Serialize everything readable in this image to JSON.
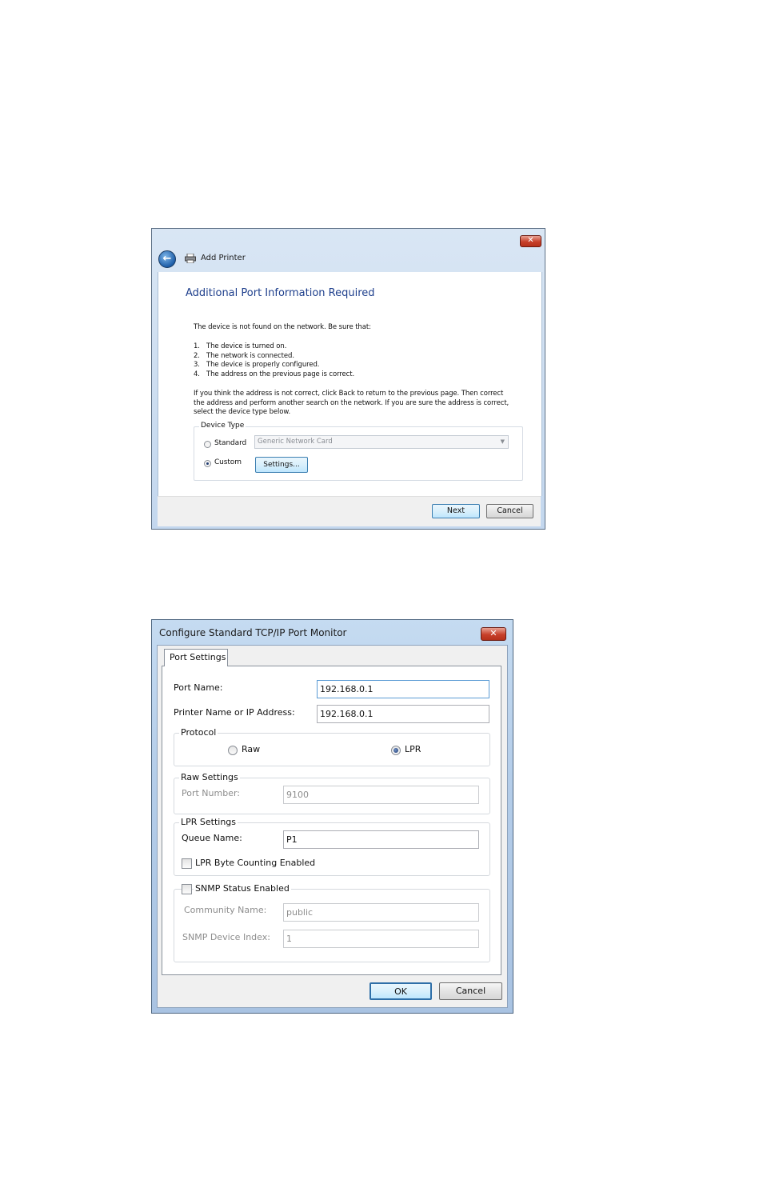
{
  "add_printer": {
    "title": "Add Printer",
    "heading": "Additional Port Information Required",
    "intro": "The device is not found on the network.  Be sure that:",
    "checks": [
      {
        "num": "1.",
        "text": "The device is turned on."
      },
      {
        "num": "2.",
        "text": "The network is connected."
      },
      {
        "num": "3.",
        "text": "The device is properly configured."
      },
      {
        "num": "4.",
        "text": "The address on the previous page is correct."
      }
    ],
    "advice_lines": [
      "If you think the address is not correct, click Back to return to the previous page.  Then correct",
      "the address and perform another search on the network.  If you are sure the address is correct,",
      "select the device type below."
    ],
    "device_type": {
      "legend": "Device Type",
      "standard_label": "Standard",
      "standard_selected": false,
      "standard_value": "Generic Network Card",
      "custom_label": "Custom",
      "custom_selected": true,
      "settings_button": "Settings..."
    },
    "buttons": {
      "next": "Next",
      "cancel": "Cancel"
    }
  },
  "tcpip": {
    "title": "Configure Standard TCP/IP Port Monitor",
    "tab": "Port Settings",
    "port_name_label": "Port Name:",
    "port_name": "192.168.0.1",
    "address_label": "Printer Name or IP Address:",
    "address": "192.168.0.1",
    "protocol": {
      "legend": "Protocol",
      "raw_label": "Raw",
      "raw_selected": false,
      "lpr_label": "LPR",
      "lpr_selected": true
    },
    "raw_settings": {
      "legend": "Raw Settings",
      "port_number_label": "Port Number:",
      "port_number": "9100"
    },
    "lpr_settings": {
      "legend": "LPR Settings",
      "queue_name_label": "Queue Name:",
      "queue_name": "P1",
      "byte_counting_label": "LPR Byte Counting Enabled",
      "byte_counting_checked": false
    },
    "snmp": {
      "enabled_label": "SNMP Status Enabled",
      "enabled_checked": false,
      "community_label": "Community Name:",
      "community": "public",
      "device_index_label": "SNMP Device Index:",
      "device_index": "1"
    },
    "buttons": {
      "ok": "OK",
      "cancel": "Cancel"
    }
  }
}
